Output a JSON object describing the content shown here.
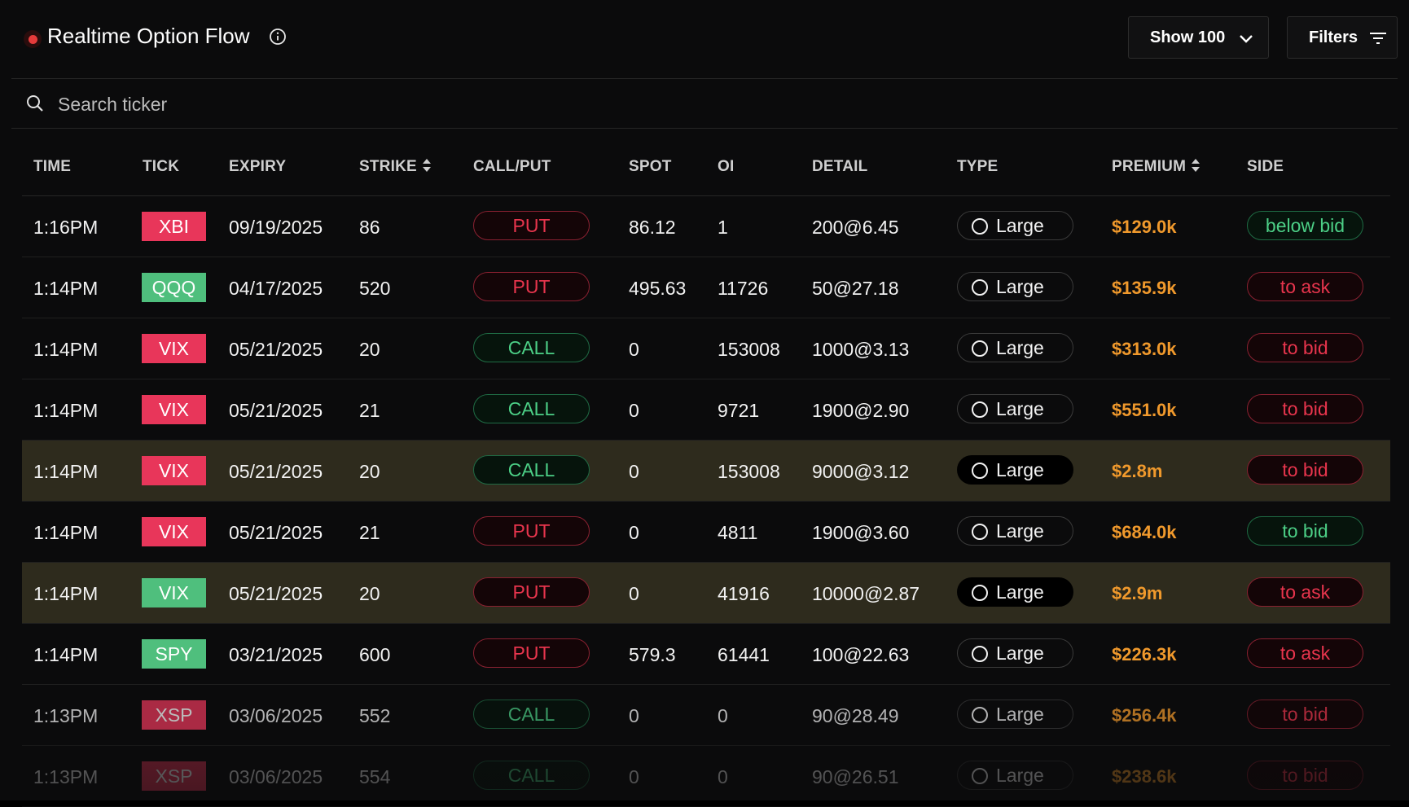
{
  "header": {
    "title": "Realtime Option Flow",
    "show_label": "Show 100",
    "filters_label": "Filters"
  },
  "search": {
    "placeholder": "Search ticker"
  },
  "columns": [
    "TIME",
    "TICK",
    "EXPIRY",
    "STRIKE",
    "CALL/PUT",
    "SPOT",
    "OI",
    "DETAIL",
    "TYPE",
    "PREMIUM",
    "SIDE"
  ],
  "colors": {
    "live_dot": "#e53b3b",
    "tick_red": "#e8365a",
    "tick_green": "#4fbf7d",
    "premium": "#f0992c",
    "put": "#e8354d",
    "call": "#4ccf86",
    "highlight_row": "#2e2b1d"
  },
  "rows": [
    {
      "time": "1:16PM",
      "tick": "XBI",
      "tick_color": "red",
      "expiry": "09/19/2025",
      "strike": "86",
      "cp": "PUT",
      "spot": "86.12",
      "oi": "1",
      "detail": "200@6.45",
      "type": "Large",
      "premium": "$129.0k",
      "side": "below bid",
      "side_color": "green",
      "highlight": false
    },
    {
      "time": "1:14PM",
      "tick": "QQQ",
      "tick_color": "green",
      "expiry": "04/17/2025",
      "strike": "520",
      "cp": "PUT",
      "spot": "495.63",
      "oi": "11726",
      "detail": "50@27.18",
      "type": "Large",
      "premium": "$135.9k",
      "side": "to ask",
      "side_color": "red",
      "highlight": false
    },
    {
      "time": "1:14PM",
      "tick": "VIX",
      "tick_color": "red",
      "expiry": "05/21/2025",
      "strike": "20",
      "cp": "CALL",
      "spot": "0",
      "oi": "153008",
      "detail": "1000@3.13",
      "type": "Large",
      "premium": "$313.0k",
      "side": "to bid",
      "side_color": "red",
      "highlight": false
    },
    {
      "time": "1:14PM",
      "tick": "VIX",
      "tick_color": "red",
      "expiry": "05/21/2025",
      "strike": "21",
      "cp": "CALL",
      "spot": "0",
      "oi": "9721",
      "detail": "1900@2.90",
      "type": "Large",
      "premium": "$551.0k",
      "side": "to bid",
      "side_color": "red",
      "highlight": false
    },
    {
      "time": "1:14PM",
      "tick": "VIX",
      "tick_color": "red",
      "expiry": "05/21/2025",
      "strike": "20",
      "cp": "CALL",
      "spot": "0",
      "oi": "153008",
      "detail": "9000@3.12",
      "type": "Large",
      "premium": "$2.8m",
      "side": "to bid",
      "side_color": "red",
      "highlight": true
    },
    {
      "time": "1:14PM",
      "tick": "VIX",
      "tick_color": "red",
      "expiry": "05/21/2025",
      "strike": "21",
      "cp": "PUT",
      "spot": "0",
      "oi": "4811",
      "detail": "1900@3.60",
      "type": "Large",
      "premium": "$684.0k",
      "side": "to bid",
      "side_color": "green",
      "highlight": false
    },
    {
      "time": "1:14PM",
      "tick": "VIX",
      "tick_color": "green",
      "expiry": "05/21/2025",
      "strike": "20",
      "cp": "PUT",
      "spot": "0",
      "oi": "41916",
      "detail": "10000@2.87",
      "type": "Large",
      "premium": "$2.9m",
      "side": "to ask",
      "side_color": "red",
      "highlight": true
    },
    {
      "time": "1:14PM",
      "tick": "SPY",
      "tick_color": "green",
      "expiry": "03/21/2025",
      "strike": "600",
      "cp": "PUT",
      "spot": "579.3",
      "oi": "61441",
      "detail": "100@22.63",
      "type": "Large",
      "premium": "$226.3k",
      "side": "to ask",
      "side_color": "red",
      "highlight": false
    },
    {
      "time": "1:13PM",
      "tick": "XSP",
      "tick_color": "red",
      "expiry": "03/06/2025",
      "strike": "552",
      "cp": "CALL",
      "spot": "0",
      "oi": "0",
      "detail": "90@28.49",
      "type": "Large",
      "premium": "$256.4k",
      "side": "to bid",
      "side_color": "red",
      "highlight": false
    },
    {
      "time": "1:13PM",
      "tick": "XSP",
      "tick_color": "red",
      "expiry": "03/06/2025",
      "strike": "554",
      "cp": "CALL",
      "spot": "0",
      "oi": "0",
      "detail": "90@26.51",
      "type": "Large",
      "premium": "$238.6k",
      "side": "to bid",
      "side_color": "red",
      "highlight": false
    }
  ]
}
